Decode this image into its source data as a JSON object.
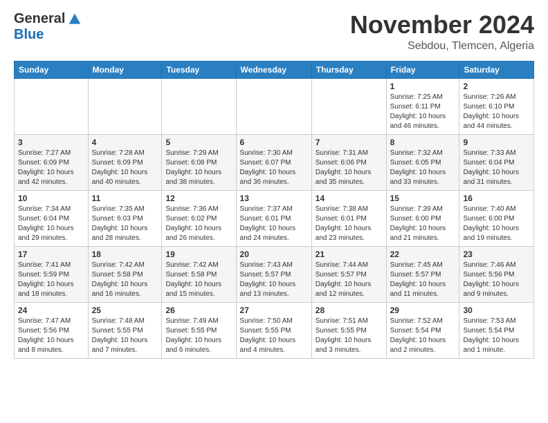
{
  "header": {
    "logo_general": "General",
    "logo_blue": "Blue",
    "month_title": "November 2024",
    "location": "Sebdou, Tlemcen, Algeria"
  },
  "days_of_week": [
    "Sunday",
    "Monday",
    "Tuesday",
    "Wednesday",
    "Thursday",
    "Friday",
    "Saturday"
  ],
  "weeks": [
    [
      {
        "day": "",
        "info": ""
      },
      {
        "day": "",
        "info": ""
      },
      {
        "day": "",
        "info": ""
      },
      {
        "day": "",
        "info": ""
      },
      {
        "day": "",
        "info": ""
      },
      {
        "day": "1",
        "info": "Sunrise: 7:25 AM\nSunset: 6:11 PM\nDaylight: 10 hours and 46 minutes."
      },
      {
        "day": "2",
        "info": "Sunrise: 7:26 AM\nSunset: 6:10 PM\nDaylight: 10 hours and 44 minutes."
      }
    ],
    [
      {
        "day": "3",
        "info": "Sunrise: 7:27 AM\nSunset: 6:09 PM\nDaylight: 10 hours and 42 minutes."
      },
      {
        "day": "4",
        "info": "Sunrise: 7:28 AM\nSunset: 6:09 PM\nDaylight: 10 hours and 40 minutes."
      },
      {
        "day": "5",
        "info": "Sunrise: 7:29 AM\nSunset: 6:08 PM\nDaylight: 10 hours and 38 minutes."
      },
      {
        "day": "6",
        "info": "Sunrise: 7:30 AM\nSunset: 6:07 PM\nDaylight: 10 hours and 36 minutes."
      },
      {
        "day": "7",
        "info": "Sunrise: 7:31 AM\nSunset: 6:06 PM\nDaylight: 10 hours and 35 minutes."
      },
      {
        "day": "8",
        "info": "Sunrise: 7:32 AM\nSunset: 6:05 PM\nDaylight: 10 hours and 33 minutes."
      },
      {
        "day": "9",
        "info": "Sunrise: 7:33 AM\nSunset: 6:04 PM\nDaylight: 10 hours and 31 minutes."
      }
    ],
    [
      {
        "day": "10",
        "info": "Sunrise: 7:34 AM\nSunset: 6:04 PM\nDaylight: 10 hours and 29 minutes."
      },
      {
        "day": "11",
        "info": "Sunrise: 7:35 AM\nSunset: 6:03 PM\nDaylight: 10 hours and 28 minutes."
      },
      {
        "day": "12",
        "info": "Sunrise: 7:36 AM\nSunset: 6:02 PM\nDaylight: 10 hours and 26 minutes."
      },
      {
        "day": "13",
        "info": "Sunrise: 7:37 AM\nSunset: 6:01 PM\nDaylight: 10 hours and 24 minutes."
      },
      {
        "day": "14",
        "info": "Sunrise: 7:38 AM\nSunset: 6:01 PM\nDaylight: 10 hours and 23 minutes."
      },
      {
        "day": "15",
        "info": "Sunrise: 7:39 AM\nSunset: 6:00 PM\nDaylight: 10 hours and 21 minutes."
      },
      {
        "day": "16",
        "info": "Sunrise: 7:40 AM\nSunset: 6:00 PM\nDaylight: 10 hours and 19 minutes."
      }
    ],
    [
      {
        "day": "17",
        "info": "Sunrise: 7:41 AM\nSunset: 5:59 PM\nDaylight: 10 hours and 18 minutes."
      },
      {
        "day": "18",
        "info": "Sunrise: 7:42 AM\nSunset: 5:58 PM\nDaylight: 10 hours and 16 minutes."
      },
      {
        "day": "19",
        "info": "Sunrise: 7:42 AM\nSunset: 5:58 PM\nDaylight: 10 hours and 15 minutes."
      },
      {
        "day": "20",
        "info": "Sunrise: 7:43 AM\nSunset: 5:57 PM\nDaylight: 10 hours and 13 minutes."
      },
      {
        "day": "21",
        "info": "Sunrise: 7:44 AM\nSunset: 5:57 PM\nDaylight: 10 hours and 12 minutes."
      },
      {
        "day": "22",
        "info": "Sunrise: 7:45 AM\nSunset: 5:57 PM\nDaylight: 10 hours and 11 minutes."
      },
      {
        "day": "23",
        "info": "Sunrise: 7:46 AM\nSunset: 5:56 PM\nDaylight: 10 hours and 9 minutes."
      }
    ],
    [
      {
        "day": "24",
        "info": "Sunrise: 7:47 AM\nSunset: 5:56 PM\nDaylight: 10 hours and 8 minutes."
      },
      {
        "day": "25",
        "info": "Sunrise: 7:48 AM\nSunset: 5:55 PM\nDaylight: 10 hours and 7 minutes."
      },
      {
        "day": "26",
        "info": "Sunrise: 7:49 AM\nSunset: 5:55 PM\nDaylight: 10 hours and 6 minutes."
      },
      {
        "day": "27",
        "info": "Sunrise: 7:50 AM\nSunset: 5:55 PM\nDaylight: 10 hours and 4 minutes."
      },
      {
        "day": "28",
        "info": "Sunrise: 7:51 AM\nSunset: 5:55 PM\nDaylight: 10 hours and 3 minutes."
      },
      {
        "day": "29",
        "info": "Sunrise: 7:52 AM\nSunset: 5:54 PM\nDaylight: 10 hours and 2 minutes."
      },
      {
        "day": "30",
        "info": "Sunrise: 7:53 AM\nSunset: 5:54 PM\nDaylight: 10 hours and 1 minute."
      }
    ]
  ]
}
